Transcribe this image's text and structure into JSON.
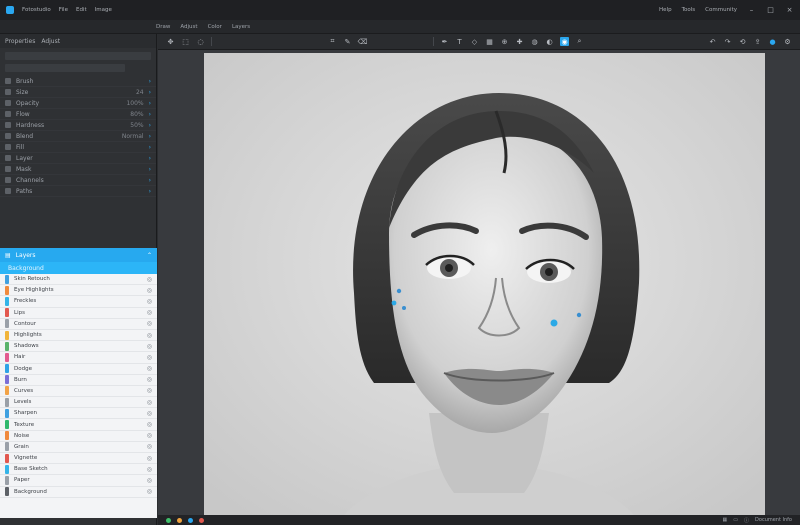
{
  "titlebar": {
    "menu": [
      "Fotostudio",
      "File",
      "Edit",
      "Image"
    ],
    "right": [
      "Help",
      "Tools",
      "Community"
    ]
  },
  "menubar": {
    "tabs": [
      "Draw",
      "Adjust",
      "Color",
      "Layers"
    ]
  },
  "leftpanel": {
    "header": [
      "Properties",
      "Adjust"
    ],
    "rows": [
      {
        "label": "Brush",
        "value": ""
      },
      {
        "label": "Size",
        "value": "24"
      },
      {
        "label": "Opacity",
        "value": "100%"
      },
      {
        "label": "Flow",
        "value": "80%"
      },
      {
        "label": "Hardness",
        "value": "50%"
      },
      {
        "label": "Blend",
        "value": "Normal"
      },
      {
        "label": "Fill",
        "value": ""
      },
      {
        "label": "Layer",
        "value": ""
      },
      {
        "label": "Mask",
        "value": ""
      },
      {
        "label": "Channels",
        "value": ""
      },
      {
        "label": "Paths",
        "value": ""
      }
    ]
  },
  "layers": {
    "title": "Layers",
    "subtitle": "Background",
    "items": [
      {
        "name": "Skin Retouch",
        "color": "#3fa0e0"
      },
      {
        "name": "Eye Highlights",
        "color": "#f08a3e"
      },
      {
        "name": "Freckles",
        "color": "#34b4e8"
      },
      {
        "name": "Lips",
        "color": "#e2584f"
      },
      {
        "name": "Contour",
        "color": "#9aa0a8"
      },
      {
        "name": "Highlights",
        "color": "#f1b43a"
      },
      {
        "name": "Shadows",
        "color": "#59b36b"
      },
      {
        "name": "Hair",
        "color": "#e25b8f"
      },
      {
        "name": "Dodge",
        "color": "#2fa3e6"
      },
      {
        "name": "Burn",
        "color": "#7b6ed6"
      },
      {
        "name": "Curves",
        "color": "#f2a347"
      },
      {
        "name": "Levels",
        "color": "#9aa0a8"
      },
      {
        "name": "Sharpen",
        "color": "#3fa0e0"
      },
      {
        "name": "Texture",
        "color": "#2fb86d"
      },
      {
        "name": "Noise",
        "color": "#f08a3e"
      },
      {
        "name": "Grain",
        "color": "#9aa0a8"
      },
      {
        "name": "Vignette",
        "color": "#e2584f"
      },
      {
        "name": "Base Sketch",
        "color": "#34b4e8"
      },
      {
        "name": "Paper",
        "color": "#9aa0a8"
      },
      {
        "name": "Background",
        "color": "#5d6167"
      }
    ]
  },
  "statusbar": {
    "right": "Document Info"
  },
  "colors": {
    "accent": "#2aa7f0",
    "panel": "#2f3134",
    "canvas": "#383a3e"
  }
}
